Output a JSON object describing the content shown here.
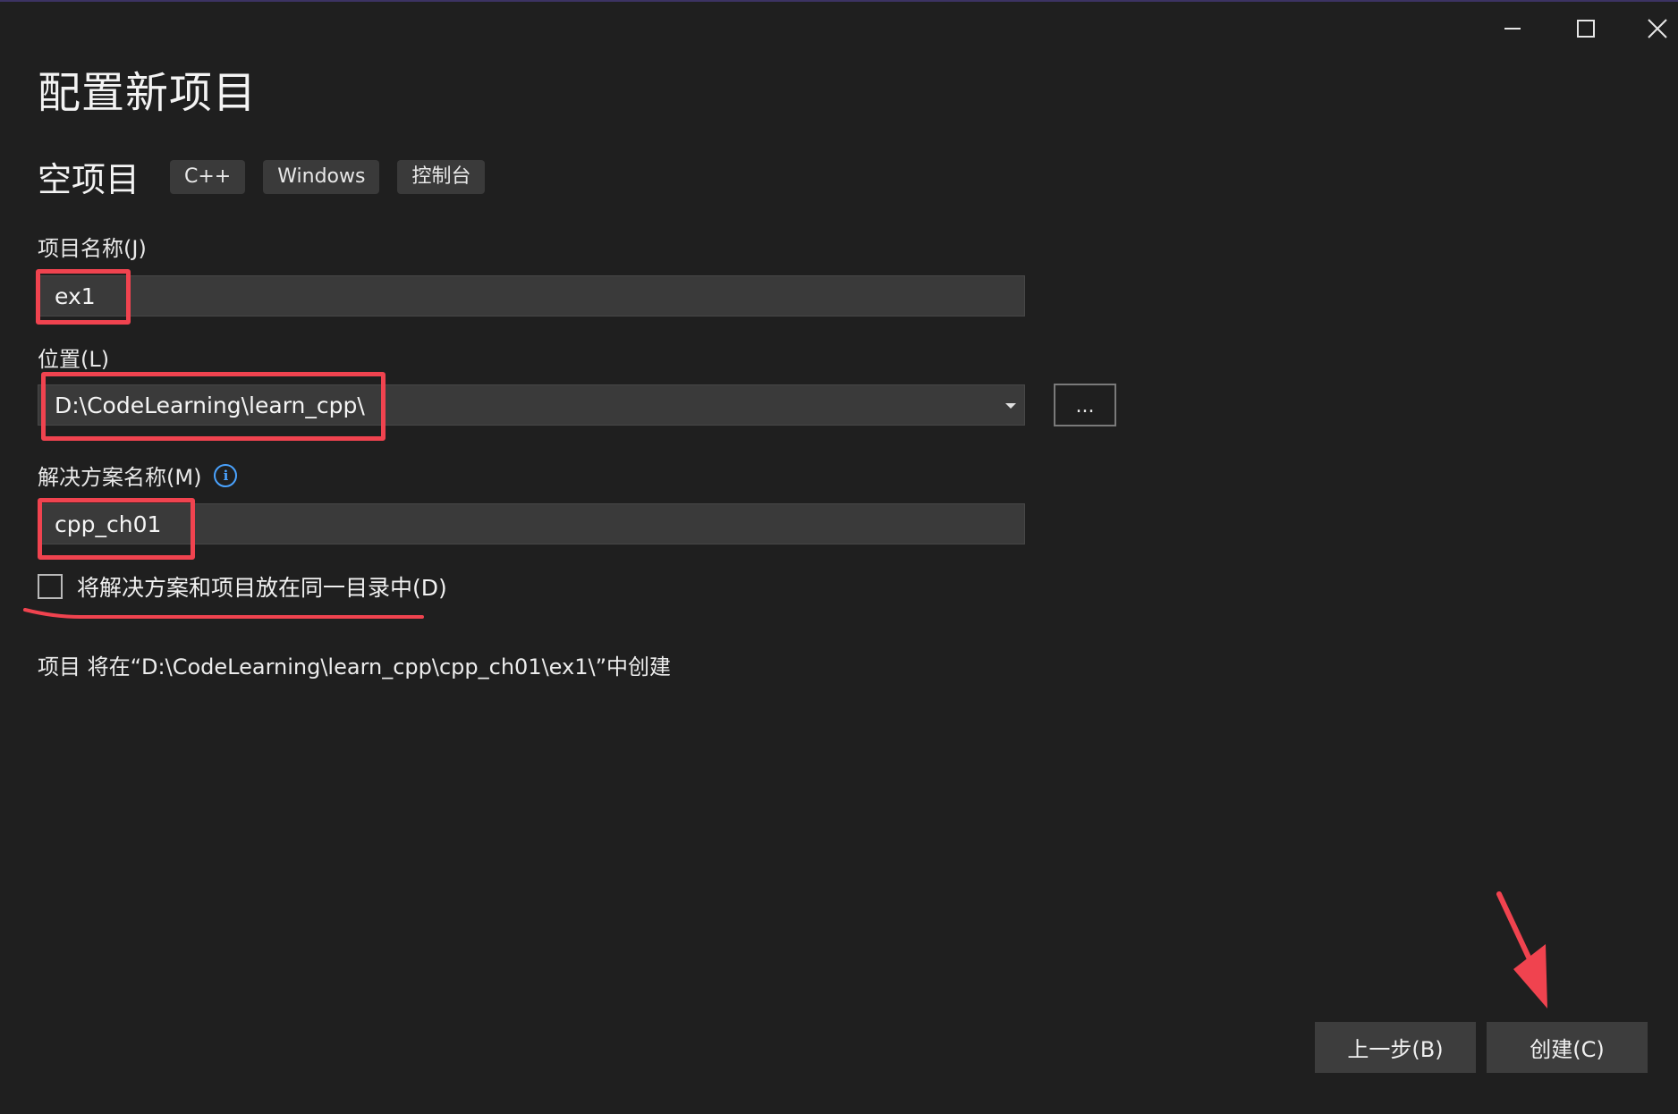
{
  "window": {
    "caption": {
      "minimize_icon": "minimize-icon",
      "maximize_icon": "maximize-icon",
      "close_icon": "close-icon"
    }
  },
  "page": {
    "title": "配置新项目",
    "template_name": "空项目",
    "tags": [
      "C++",
      "Windows",
      "控制台"
    ]
  },
  "form": {
    "project_name": {
      "label": "项目名称(J)",
      "value": "ex1"
    },
    "location": {
      "label": "位置(L)",
      "value": "D:\\CodeLearning\\learn_cpp\\",
      "browse_label": "..."
    },
    "solution_name": {
      "label": "解决方案名称(M)",
      "value": "cpp_ch01",
      "info_icon": "info-icon"
    },
    "same_dir_checkbox": {
      "label": "将解决方案和项目放在同一目录中(D)",
      "checked": false
    },
    "summary": "项目 将在“D:\\CodeLearning\\learn_cpp\\cpp_ch01\\ex1\\”中创建"
  },
  "footer": {
    "back_label": "上一步(B)",
    "create_label": "创建(C)"
  },
  "colors": {
    "background": "#1f1f1f",
    "input_bg": "#3a3a3a",
    "button_bg": "#3d3d3d",
    "annotation_red": "#f0434f",
    "info_blue": "#4aa3ff"
  }
}
